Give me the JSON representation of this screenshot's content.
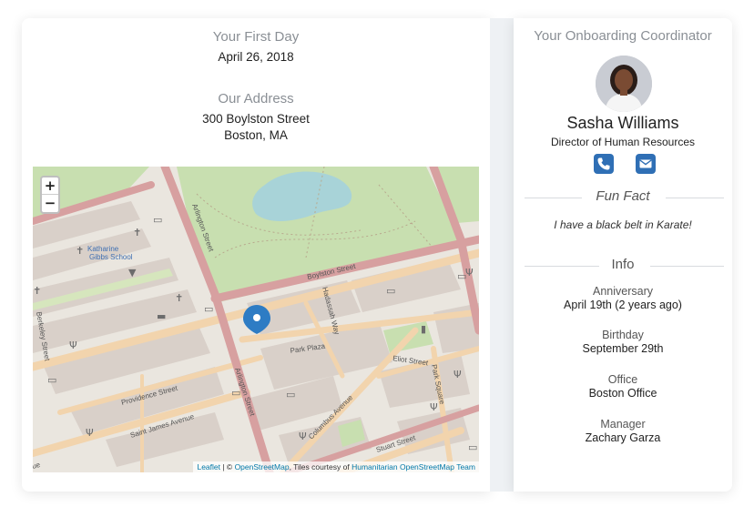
{
  "first_day": {
    "title": "Your First Day",
    "date": "April 26, 2018"
  },
  "address": {
    "title": "Our Address",
    "line1": "300 Boylston Street",
    "line2": "Boston, MA"
  },
  "map": {
    "zoom_in": "+",
    "zoom_out": "−",
    "labels": {
      "school_1": "Katharine",
      "school_2": "Gibbs School",
      "arlington_top": "Arlington Street",
      "arlington_bottom": "Arlington Street",
      "boylston": "Boylston Street",
      "hadassah": "Hadassah Way",
      "park_plaza": "Park Plaza",
      "eliot": "Eliot Street",
      "park_square": "Park Square",
      "providence": "Providence Street",
      "saint_james": "Saint James Avenue",
      "columbus": "Columbus Avenue",
      "stuart": "Stuart Street",
      "berkeley": "Berkeley Street",
      "edge_ue": "ue"
    },
    "attribution": {
      "leaflet": "Leaflet",
      "sep1": " | © ",
      "osm": "OpenStreetMap",
      "mid": ", Tiles courtesy of ",
      "hot": "Humanitarian OpenStreetMap Team"
    },
    "colors": {
      "park": "#c8dfb0",
      "water": "#a8d3d8",
      "major_road": "#d7a0a0",
      "minor_road": "#f2d4ad",
      "building": "#d9d0c9",
      "marker": "#2e7cc4"
    }
  },
  "coordinator": {
    "title": "Your Onboarding Coordinator",
    "name": "Sasha Williams",
    "role": "Director of Human Resources",
    "phone_icon": "phone-icon",
    "email_icon": "envelope-icon"
  },
  "fun_fact": {
    "heading": "Fun Fact",
    "text": "I have a black belt in Karate!"
  },
  "info": {
    "heading": "Info",
    "anniversary_label": "Anniversary",
    "anniversary_value": "April 19th (2 years ago)",
    "birthday_label": "Birthday",
    "birthday_value": "September 29th",
    "office_label": "Office",
    "office_value": "Boston Office",
    "manager_label": "Manager",
    "manager_value": "Zachary Garza"
  }
}
